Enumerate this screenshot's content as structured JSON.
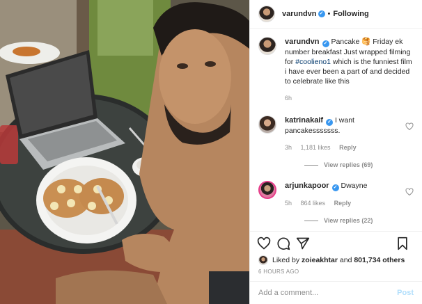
{
  "post_image": {
    "alt": "Man smiling at camera with a plate of banana pancakes next to a laptop"
  },
  "header": {
    "username": "varundvn",
    "verified_mark": "✓",
    "separator": "•",
    "follow_status": "Following"
  },
  "caption": {
    "username": "varundvn",
    "text_before_hashtag": "Pancake 🥞 Friday ek number breakfast Just wrapped filming for ",
    "hashtag": "#coolieno1",
    "text_after_hashtag": " which is the funniest film i have ever been a part of and decided to celebrate like this",
    "time": "6h"
  },
  "comments": [
    {
      "username": "katrinakaif",
      "text": "I want pancakesssssss.",
      "time": "3h",
      "likes": "1,181 likes",
      "reply_label": "Reply",
      "view_replies": "View replies (69)"
    },
    {
      "username": "arjunkapoor",
      "text": "Dwayne",
      "time": "5h",
      "likes": "864 likes",
      "reply_label": "Reply",
      "view_replies": "View replies (22)"
    }
  ],
  "actions": {
    "icons": [
      "heart-icon",
      "comment-icon",
      "share-icon",
      "bookmark-icon"
    ]
  },
  "likes": {
    "prefix": "Liked by ",
    "user": "zoieakhtar",
    "middle": " and ",
    "others": "801,734 others"
  },
  "timestamp": "6 HOURS AGO",
  "add_comment": {
    "placeholder": "Add a comment...",
    "post_label": "Post"
  },
  "colors": {
    "link": "#00376b",
    "verified": "#3897f0",
    "muted": "#8e8e8e",
    "post_disabled": "#b2dffc"
  }
}
